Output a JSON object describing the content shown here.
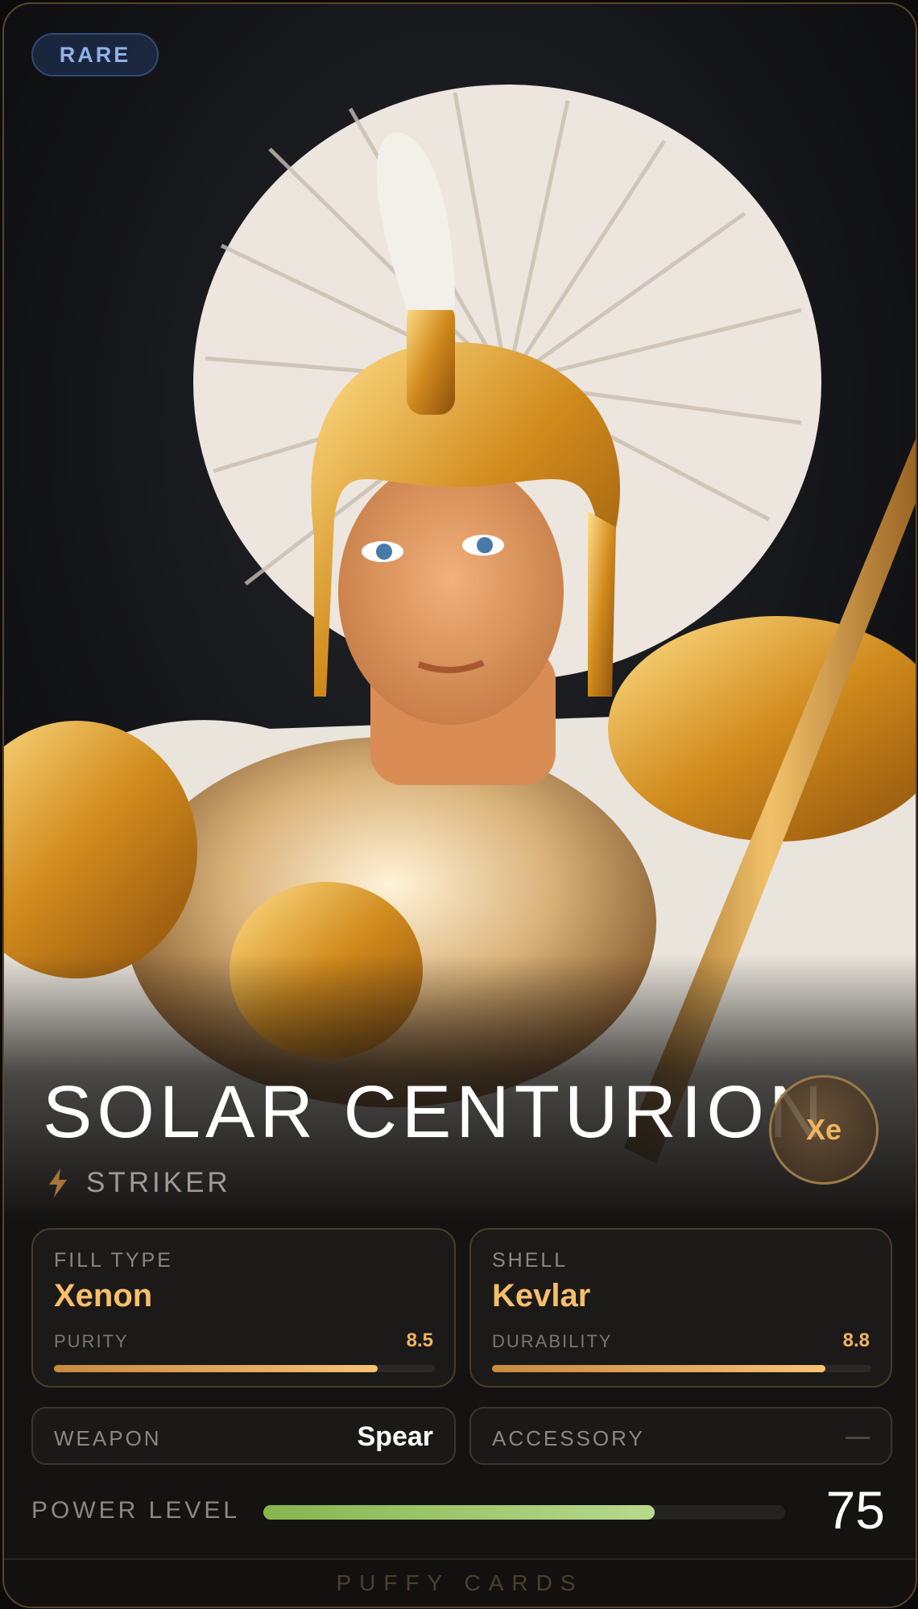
{
  "card": {
    "rarity": "RARE",
    "name": "SOLAR CENTURION",
    "element_symbol": "Xe",
    "role": "STRIKER",
    "role_icon": "lightning-bolt-icon"
  },
  "stats": {
    "fill": {
      "label": "FILL TYPE",
      "value": "Xenon",
      "stat_label": "PURITY",
      "stat_value": "8.5",
      "stat_fraction": 0.85
    },
    "shell": {
      "label": "SHELL",
      "value": "Kevlar",
      "stat_label": "DURABILITY",
      "stat_value": "8.8",
      "stat_fraction": 0.88
    }
  },
  "slots": {
    "weapon": {
      "label": "WEAPON",
      "value": "Spear"
    },
    "accessory": {
      "label": "ACCESSORY",
      "value": "—"
    }
  },
  "power": {
    "label": "POWER LEVEL",
    "value": "75",
    "fraction": 0.75
  },
  "footer": {
    "brand": "PUFFY CARDS"
  },
  "colors": {
    "accent": "#f7be6c",
    "rarity": "#8fb2e8",
    "power": "#9cc76b",
    "border": "#5a4526"
  }
}
